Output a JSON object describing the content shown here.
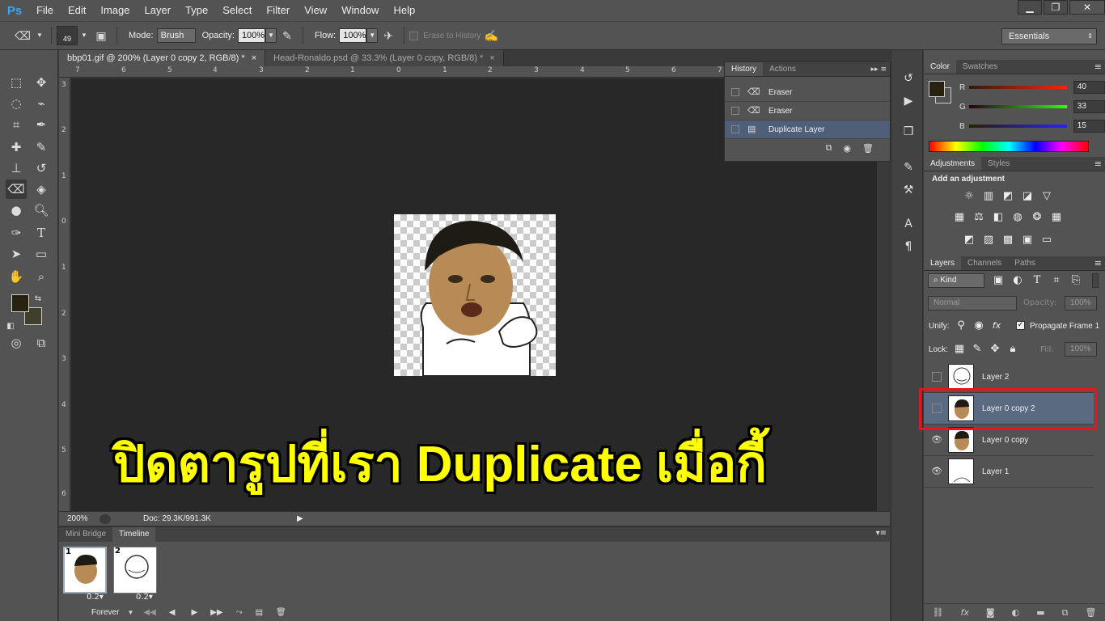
{
  "app": {
    "logo": "Ps"
  },
  "menu": [
    "File",
    "Edit",
    "Image",
    "Layer",
    "Type",
    "Select",
    "Filter",
    "View",
    "Window",
    "Help"
  ],
  "window_controls": [
    "minimize",
    "restore",
    "close"
  ],
  "options_bar": {
    "brush_size": "49",
    "mode_label": "Mode:",
    "mode_value": "Brush",
    "opacity_label": "Opacity:",
    "opacity_value": "100%",
    "flow_label": "Flow:",
    "flow_value": "100%",
    "erase_to_history": "Erase to History",
    "workspace": "Essentials"
  },
  "doc_tabs": [
    {
      "label": "bbp01.gif @ 200% (Layer 0 copy 2, RGB/8) *",
      "active": true
    },
    {
      "label": "Head-Ronaldo.psd @ 33.3% (Layer 0 copy, RGB/8) *",
      "active": false
    }
  ],
  "ruler_top": [
    "7",
    "6",
    "5",
    "4",
    "3",
    "2",
    "1",
    "0",
    "1",
    "2",
    "3",
    "4",
    "5",
    "6",
    "7"
  ],
  "ruler_left": [
    "3",
    "2",
    "1",
    "0",
    "1",
    "2",
    "3",
    "4",
    "5",
    "6"
  ],
  "caption": "ปิดตารูปที่เรา Duplicate เมื่อกี้",
  "status": {
    "zoom": "200%",
    "doc": "Doc: 29.3K/991.3K"
  },
  "timeline": {
    "tabs": [
      "Mini Bridge",
      "Timeline"
    ],
    "frames": [
      {
        "num": "1",
        "delay": "0.2▾"
      },
      {
        "num": "2",
        "delay": "0.2▾"
      }
    ],
    "loop": "Forever"
  },
  "history": {
    "tabs": [
      "History",
      "Actions"
    ],
    "items": [
      {
        "label": "Eraser",
        "selected": false
      },
      {
        "label": "Eraser",
        "selected": false
      },
      {
        "label": "Duplicate Layer",
        "selected": true
      }
    ]
  },
  "color_panel": {
    "tabs": [
      "Color",
      "Swatches"
    ],
    "r": "40",
    "g": "33",
    "b": "15",
    "r_label": "R",
    "g_label": "G",
    "b_label": "B",
    "fg_color": "#28210f"
  },
  "adjustments": {
    "tabs": [
      "Adjustments",
      "Styles"
    ],
    "title": "Add an adjustment"
  },
  "layers": {
    "tabs": [
      "Layers",
      "Channels",
      "Paths"
    ],
    "filter": "Kind",
    "blend": "Normal",
    "opacity_label": "Opacity:",
    "opacity_value": "100%",
    "unify_label": "Unify:",
    "propagate": "Propagate Frame 1",
    "lock_label": "Lock:",
    "fill_label": "Fill:",
    "fill_value": "100%",
    "items": [
      {
        "name": "Layer 2",
        "visible": false,
        "selected": false
      },
      {
        "name": "Layer 0 copy 2",
        "visible": false,
        "selected": true
      },
      {
        "name": "Layer 0 copy",
        "visible": true,
        "selected": false
      },
      {
        "name": "Layer 1",
        "visible": true,
        "selected": false
      }
    ]
  },
  "colors": {
    "highlight": "#e8141e",
    "caption": "#ffff00",
    "selection": "#4f5f78"
  }
}
